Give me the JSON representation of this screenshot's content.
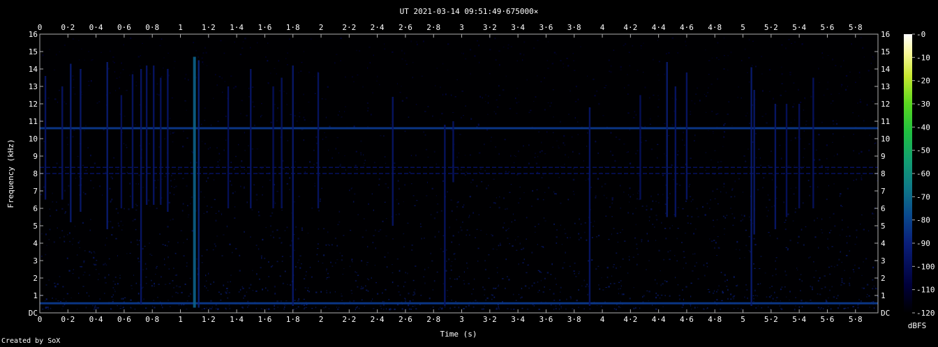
{
  "chart_data": {
    "type": "heatmap",
    "title": "UT 2021-03-14 09:51:49·675000×",
    "xlabel": "Time (s)",
    "ylabel": "Frequency (kHz)",
    "xlim": [
      0,
      5.96
    ],
    "ylim": [
      0,
      16
    ],
    "x_ticks": [
      "0",
      "0·2",
      "0·4",
      "0·6",
      "0·8",
      "1",
      "1·2",
      "1·4",
      "1·6",
      "1·8",
      "2",
      "2·2",
      "2·4",
      "2·6",
      "2·8",
      "3",
      "3·2",
      "3·4",
      "3·6",
      "3·8",
      "4",
      "4·2",
      "4·4",
      "4·6",
      "4·8",
      "5",
      "5·2",
      "5·4",
      "5·6",
      "5·8"
    ],
    "y_ticks": [
      "DC",
      "1",
      "2",
      "3",
      "4",
      "5",
      "6",
      "7",
      "8",
      "9",
      "10",
      "11",
      "12",
      "13",
      "14",
      "15",
      "16"
    ],
    "colorbar": {
      "label": "dBFS",
      "min": -120,
      "max": 0,
      "ticks": [
        "-0",
        "-10",
        "-20",
        "-30",
        "-40",
        "-50",
        "-60",
        "-70",
        "-80",
        "-90",
        "-100",
        "-110",
        "-120"
      ]
    },
    "constant_tones_khz": [
      0.55,
      8.0,
      8.35,
      10.6
    ],
    "impulses": [
      {
        "t": 0.04,
        "f_low": 6.5,
        "f_high": 13.6,
        "level": -95
      },
      {
        "t": 0.16,
        "f_low": 6.5,
        "f_high": 13.0,
        "level": -96
      },
      {
        "t": 0.22,
        "f_low": 5.2,
        "f_high": 14.3,
        "level": -92
      },
      {
        "t": 0.29,
        "f_low": 5.8,
        "f_high": 14.0,
        "level": -93
      },
      {
        "t": 0.48,
        "f_low": 4.8,
        "f_high": 14.4,
        "level": -92
      },
      {
        "t": 0.58,
        "f_low": 6.0,
        "f_high": 12.5,
        "level": -98
      },
      {
        "t": 0.66,
        "f_low": 6.0,
        "f_high": 13.7,
        "level": -96
      },
      {
        "t": 0.72,
        "f_low": 0.5,
        "f_high": 14.0,
        "level": -94
      },
      {
        "t": 0.76,
        "f_low": 6.2,
        "f_high": 14.2,
        "level": -95
      },
      {
        "t": 0.81,
        "f_low": 6.2,
        "f_high": 14.2,
        "level": -95
      },
      {
        "t": 0.86,
        "f_low": 6.2,
        "f_high": 13.5,
        "level": -97
      },
      {
        "t": 0.91,
        "f_low": 5.8,
        "f_high": 14.0,
        "level": -95
      },
      {
        "t": 1.1,
        "f_low": 0.3,
        "f_high": 14.7,
        "level": -72
      },
      {
        "t": 1.13,
        "f_low": 0.3,
        "f_high": 14.5,
        "level": -88
      },
      {
        "t": 1.34,
        "f_low": 6.0,
        "f_high": 13.0,
        "level": -98
      },
      {
        "t": 1.5,
        "f_low": 6.0,
        "f_high": 14.0,
        "level": -95
      },
      {
        "t": 1.66,
        "f_low": 6.0,
        "f_high": 13.0,
        "level": -98
      },
      {
        "t": 1.72,
        "f_low": 6.0,
        "f_high": 13.5,
        "level": -97
      },
      {
        "t": 1.8,
        "f_low": 0.4,
        "f_high": 14.2,
        "level": -93
      },
      {
        "t": 1.98,
        "f_low": 6.0,
        "f_high": 13.8,
        "level": -96
      },
      {
        "t": 2.51,
        "f_low": 5.0,
        "f_high": 12.4,
        "level": -95
      },
      {
        "t": 2.88,
        "f_low": 0.4,
        "f_high": 10.8,
        "level": -96
      },
      {
        "t": 2.94,
        "f_low": 7.5,
        "f_high": 11.0,
        "level": -96
      },
      {
        "t": 3.91,
        "f_low": 0.4,
        "f_high": 11.8,
        "level": -95
      },
      {
        "t": 4.27,
        "f_low": 6.5,
        "f_high": 12.5,
        "level": -98
      },
      {
        "t": 4.46,
        "f_low": 5.5,
        "f_high": 14.4,
        "level": -92
      },
      {
        "t": 4.52,
        "f_low": 5.5,
        "f_high": 13.0,
        "level": -95
      },
      {
        "t": 4.6,
        "f_low": 6.5,
        "f_high": 13.8,
        "level": -95
      },
      {
        "t": 5.06,
        "f_low": 0.4,
        "f_high": 14.1,
        "level": -92
      },
      {
        "t": 5.08,
        "f_low": 4.5,
        "f_high": 12.8,
        "level": -93
      },
      {
        "t": 5.23,
        "f_low": 4.8,
        "f_high": 12.0,
        "level": -94
      },
      {
        "t": 5.31,
        "f_low": 5.5,
        "f_high": 12.0,
        "level": -98
      },
      {
        "t": 5.4,
        "f_low": 6.0,
        "f_high": 12.0,
        "level": -98
      },
      {
        "t": 5.5,
        "f_low": 6.0,
        "f_high": 13.5,
        "level": -97
      }
    ]
  },
  "credit": "Created by SoX"
}
